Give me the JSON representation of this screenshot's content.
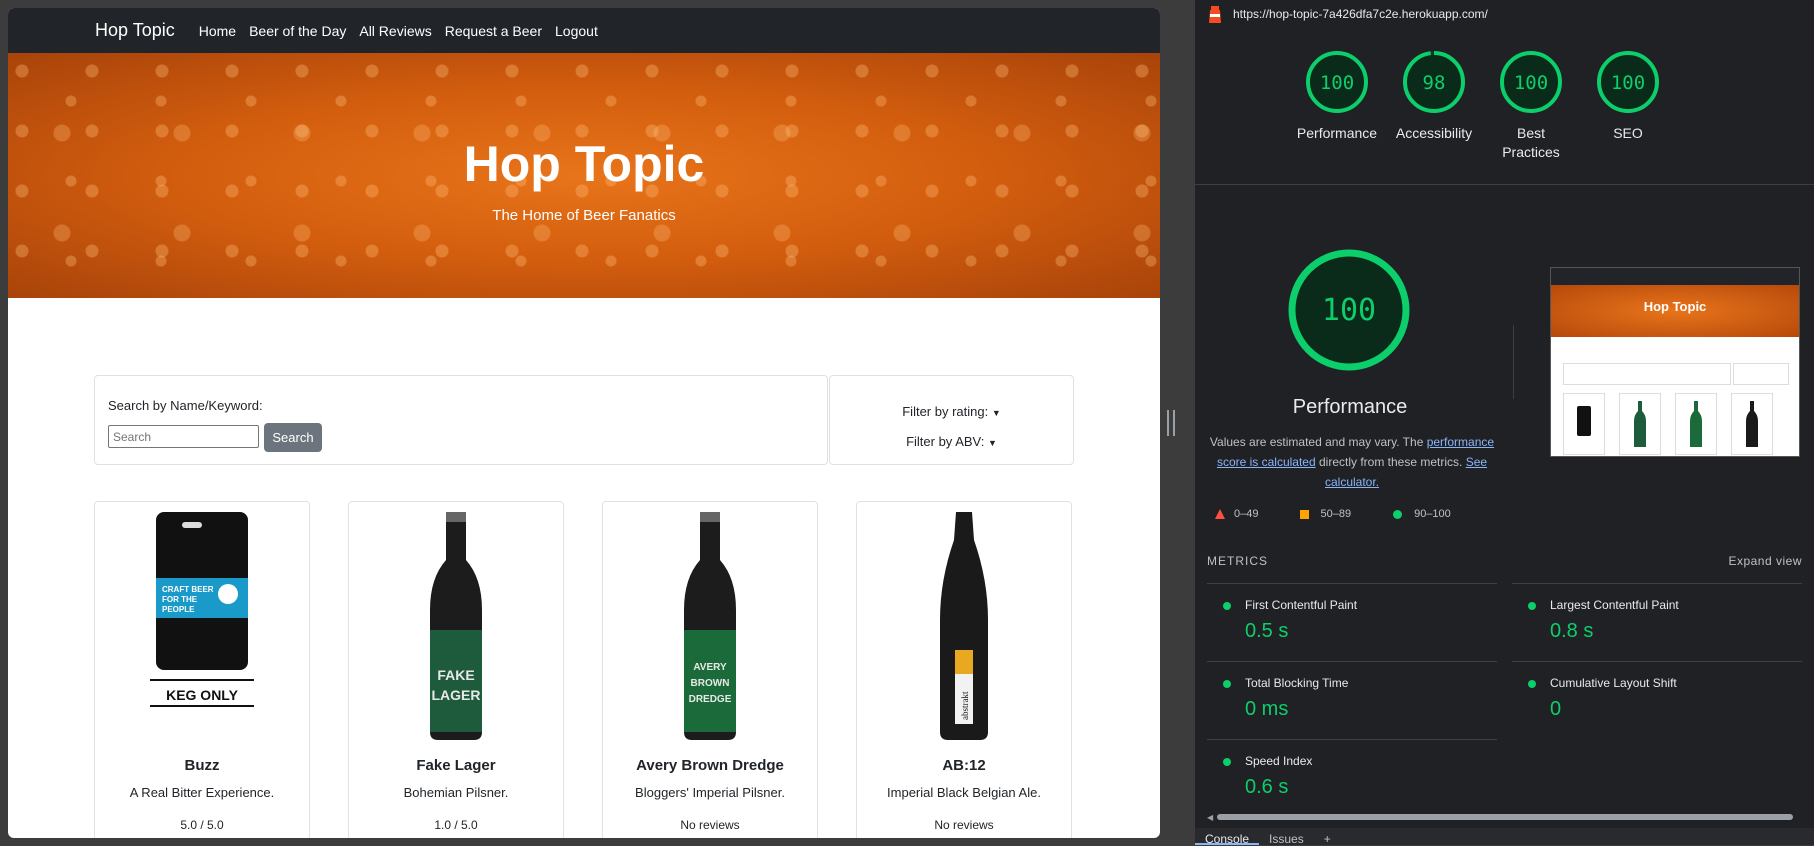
{
  "site": {
    "brand": "Hop Topic",
    "nav": [
      "Home",
      "Beer of the Day",
      "All Reviews",
      "Request a Beer",
      "Logout"
    ],
    "hero_title": "Hop Topic",
    "hero_subtitle": "The Home of Beer Fanatics",
    "search_label": "Search by Name/Keyword:",
    "search_placeholder": "Search",
    "search_button": "Search",
    "filter_rating": "Filter by rating:",
    "filter_abv": "Filter by ABV:",
    "beers": [
      {
        "name": "Buzz",
        "desc": "A Real Bitter Experience.",
        "rating": "5.0 / 5.0",
        "image": "keg-icon",
        "keg_label": "KEG ONLY",
        "badge": "CRAFT BEER FOR THE PEOPLE"
      },
      {
        "name": "Fake Lager",
        "desc": "Bohemian Pilsner.",
        "rating": "1.0 / 5.0",
        "image": "bottle-icon",
        "color": "#1e5b3c",
        "label": "FAKE LAGER"
      },
      {
        "name": "Avery Brown Dredge",
        "desc": "Bloggers' Imperial Pilsner.",
        "rating": "No reviews",
        "image": "bottle-icon",
        "color": "#1b6b3a",
        "label": "AVERY BROWN DREDGE"
      },
      {
        "name": "AB:12",
        "desc": "Imperial Black Belgian Ale.",
        "rating": "No reviews",
        "image": "bottle-icon",
        "color": "#1a1a1a",
        "label": "abstrakt"
      }
    ]
  },
  "lighthouse": {
    "url": "https://hop-topic-7a426dfa7c2e.herokuapp.com/",
    "scores": [
      {
        "label": "Performance",
        "value": 100
      },
      {
        "label": "Accessibility",
        "value": 98
      },
      {
        "label": "Best Practices",
        "value": 100
      },
      {
        "label": "SEO",
        "value": 100
      }
    ],
    "main_score": 100,
    "main_label": "Performance",
    "disclaimer_pre": "Values are estimated and may vary. The ",
    "disclaimer_link1": "performance score is calculated",
    "disclaimer_mid": " directly from these metrics. ",
    "disclaimer_link2": "See calculator.",
    "legend": [
      "0–49",
      "50–89",
      "90–100"
    ],
    "metrics_header": "METRICS",
    "expand_view": "Expand view",
    "metrics": [
      {
        "name": "First Contentful Paint",
        "value": "0.5 s"
      },
      {
        "name": "Largest Contentful Paint",
        "value": "0.8 s"
      },
      {
        "name": "Total Blocking Time",
        "value": "0 ms"
      },
      {
        "name": "Cumulative Layout Shift",
        "value": "0"
      },
      {
        "name": "Speed Index",
        "value": "0.6 s"
      }
    ],
    "thumb_title": "Hop Topic",
    "tabs": [
      "Console",
      "Issues",
      "+"
    ],
    "colors": {
      "pass": "#0cce6b",
      "average": "#ffa400",
      "fail": "#ff4e42"
    }
  }
}
